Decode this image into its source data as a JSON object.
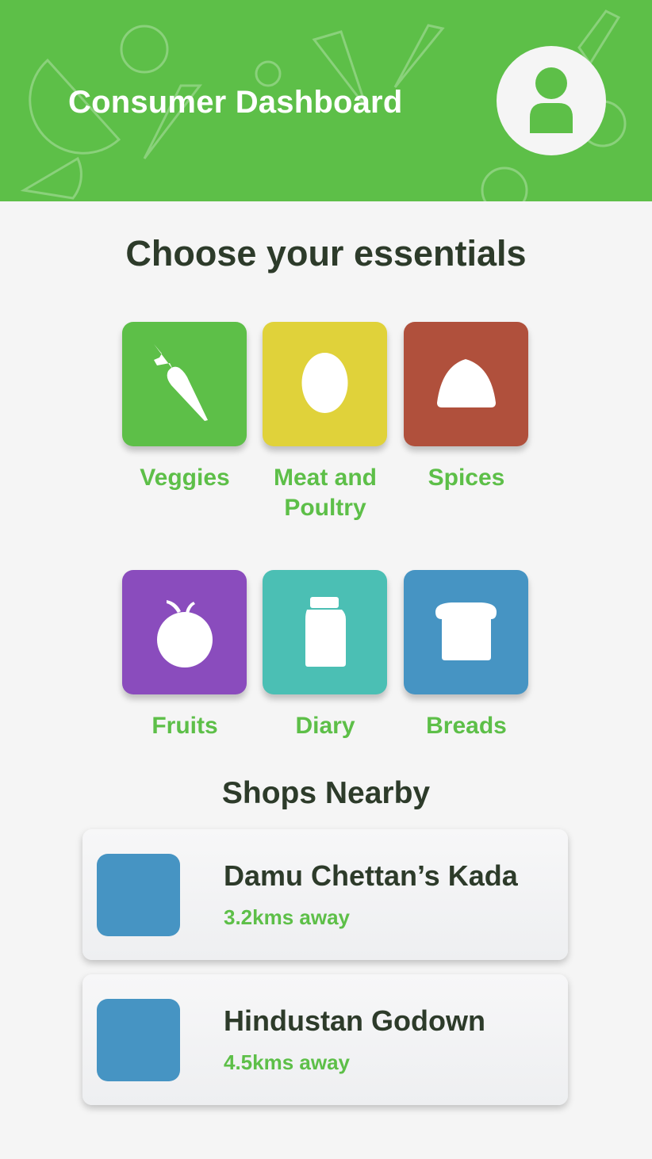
{
  "header": {
    "title": "Consumer Dashboard",
    "background_color": "#5dbf48"
  },
  "essentials": {
    "title": "Choose your essentials",
    "categories": [
      {
        "label": "Veggies",
        "icon": "carrot-icon",
        "color": "#5dbf48"
      },
      {
        "label": "Meat and Poultry",
        "icon": "egg-icon",
        "color": "#e0d23a"
      },
      {
        "label": "Spices",
        "icon": "spice-mound-icon",
        "color": "#b0503c"
      },
      {
        "label": "Fruits",
        "icon": "apple-icon",
        "color": "#8a4cbd"
      },
      {
        "label": "Diary",
        "icon": "milk-bottle-icon",
        "color": "#4bbfb4"
      },
      {
        "label": "Breads",
        "icon": "bread-icon",
        "color": "#4694c3"
      }
    ]
  },
  "shops": {
    "title": "Shops Nearby",
    "items": [
      {
        "name": "Damu Chettan’s Kada",
        "distance": "3.2kms away",
        "thumb_color": "#4694c3"
      },
      {
        "name": "Hindustan Godown",
        "distance": "4.5kms away",
        "thumb_color": "#4694c3"
      }
    ]
  },
  "colors": {
    "accent": "#5dbf48",
    "heading": "#2d3b2a",
    "background": "#f5f5f5"
  }
}
